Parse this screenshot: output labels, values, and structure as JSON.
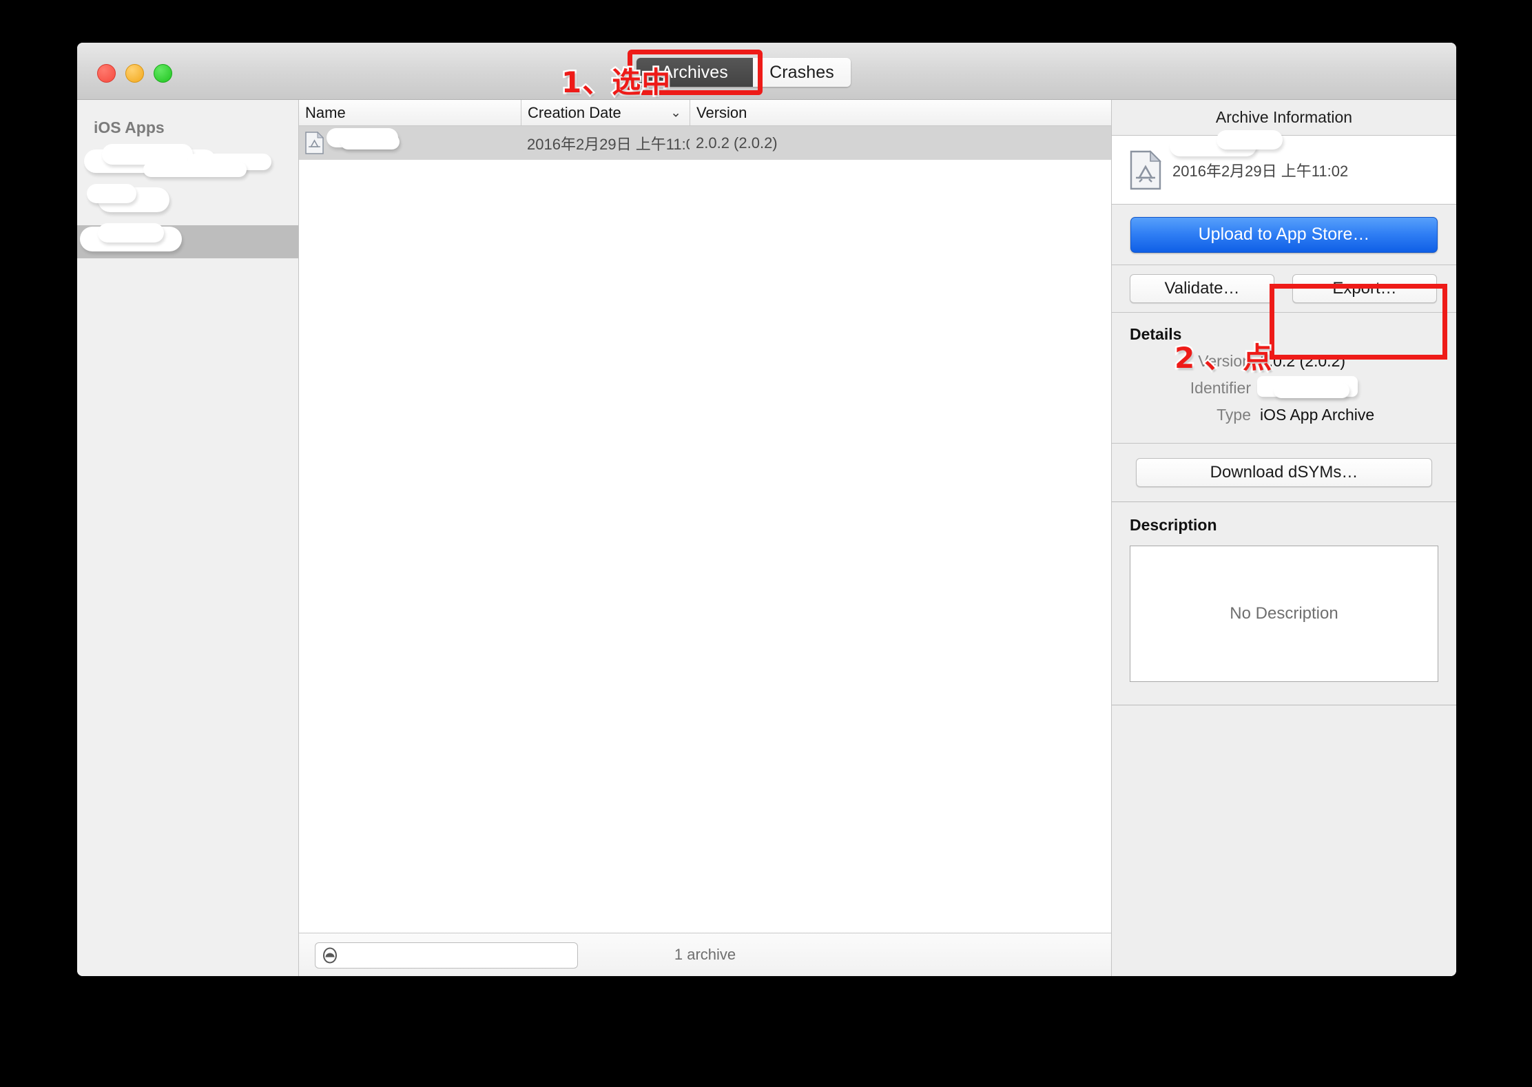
{
  "window": {
    "traffic_lights": [
      "close",
      "minimize",
      "zoom"
    ],
    "segments": [
      {
        "label": "Archives",
        "selected": true
      },
      {
        "label": "Crashes",
        "selected": false
      }
    ]
  },
  "annotations": [
    {
      "id": "step1",
      "text": "1、选中",
      "color": "#ee1b18",
      "target": "archives-tab"
    },
    {
      "id": "step2",
      "text": "2、点",
      "color": "#ee1b18",
      "target": "export-button"
    }
  ],
  "sidebar": {
    "header": "iOS Apps",
    "items": [
      {
        "label": "",
        "redacted": true,
        "selected": false
      },
      {
        "label": "",
        "redacted": true,
        "selected": false
      },
      {
        "label": "",
        "redacted": true,
        "selected": true
      }
    ]
  },
  "list": {
    "columns": [
      "Name",
      "Creation Date",
      "Version"
    ],
    "sort_column": "Creation Date",
    "sort_indicator": "⌄",
    "rows": [
      {
        "icon": "archive-document-icon",
        "name": "",
        "name_redacted": true,
        "creation_date": "2016年2月29日 上午11:02",
        "version": "2.0.2 (2.0.2)",
        "selected": true
      }
    ],
    "footer": {
      "filter_placeholder": "",
      "filter_value": "",
      "filter_icon": "archive-filter-icon",
      "count_label": "1 archive"
    }
  },
  "inspector": {
    "title": "Archive Information",
    "summary": {
      "icon": "archive-document-icon",
      "name": "",
      "name_redacted": true,
      "date": "2016年2月29日 上午11:02"
    },
    "upload_button": "Upload to App Store…",
    "validate_button": "Validate…",
    "export_button": "Export…",
    "details": {
      "title": "Details",
      "fields": [
        {
          "key": "Version",
          "value": "2.0.2 (2.0.2)",
          "redacted": false
        },
        {
          "key": "Identifier",
          "value": "",
          "redacted": true
        },
        {
          "key": "Type",
          "value": "iOS App Archive",
          "redacted": false
        }
      ]
    },
    "dsym_button": "Download dSYMs…",
    "description": {
      "title": "Description",
      "empty_text": "No Description"
    }
  },
  "colors": {
    "accent_blue": "#2f7ef4",
    "annotation_red": "#ee1b18",
    "selected_row": "#d4d4d4",
    "panel_bg": "#eeeeee",
    "segment_active": "#4a4a4a"
  }
}
